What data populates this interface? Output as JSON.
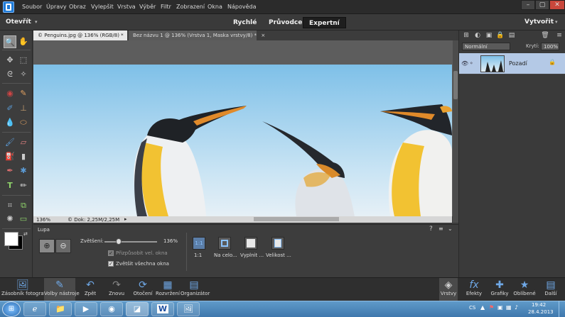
{
  "menubar": {
    "items": [
      "Soubor",
      "Úpravy",
      "Obraz",
      "Vylepšit",
      "Vrstva",
      "Výběr",
      "Filtr",
      "Zobrazení",
      "Okna",
      "Nápověda"
    ],
    "window_buttons": [
      "–",
      "▢",
      "✕"
    ]
  },
  "modebar": {
    "open_label": "Otevřít",
    "modes": [
      "Rychlé",
      "Průvodce",
      "Expertní"
    ],
    "active_mode": "Expertní",
    "create_label": "Vytvořit"
  },
  "tabs": [
    {
      "label": "© Penguins.jpg @ 136% (RGB/8) *",
      "close": "×"
    },
    {
      "label": "Bez názvu 1 @ 136% (Vrstva 1, Maska vrstvy/8) *",
      "close": "×"
    }
  ],
  "status": {
    "zoom": "136%",
    "doc": "© Dok: 2,25M/2,25M"
  },
  "layers_panel": {
    "blend_mode": "Normální",
    "opacity_label": "Krytí:",
    "opacity_value": "100%",
    "layer_name": "Pozadí"
  },
  "tool_options": {
    "tool_name": "Lupa",
    "zoom_label": "Zvětšení:",
    "zoom_value": "136%",
    "zoom_fraction": 0.27,
    "resize_windows_label": "Přizpůsobit vel. okna",
    "zoom_all_label": "Zvětšit všechna okna",
    "view_buttons": [
      {
        "icon": "1:1",
        "label": "1:1"
      },
      {
        "icon": "",
        "label": "Na celo..."
      },
      {
        "icon": "",
        "label": "Vyplnit ..."
      },
      {
        "icon": "",
        "label": "Velikost ..."
      }
    ]
  },
  "bottombar": {
    "left": [
      "Zásobník fotografií",
      "Volby nástroje",
      "Zpět",
      "Znovu",
      "Otočení",
      "Rozvržení",
      "Organizátor"
    ],
    "right": [
      "Vrstvy",
      "Efekty",
      "Grafiky",
      "Oblíbené",
      "Další"
    ]
  },
  "taskbar": {
    "language": "CS",
    "time": "19:42",
    "date": "28.4.2013"
  }
}
